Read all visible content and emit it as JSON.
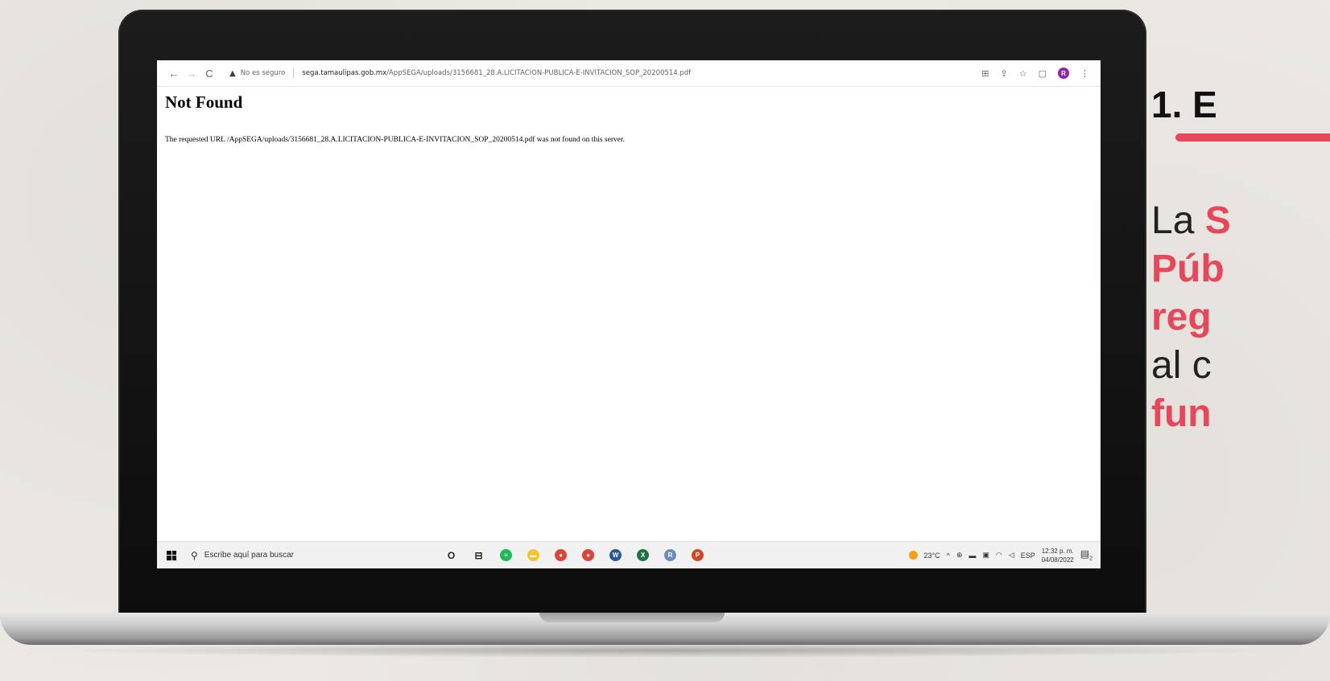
{
  "browser": {
    "back_icon": "←",
    "forward_icon": "→",
    "reload_icon": "C",
    "security_warning": "No es seguro",
    "url_host": "sega.tamaulipas.gob.mx",
    "url_path": "/AppSEGA/uploads/3156681_28.A.LICITACION-PUBLICA-E-INVITACION_SOP_20200514.pdf",
    "profile_initial": "R"
  },
  "page": {
    "heading": "Not Found",
    "message": "The requested URL /AppSEGA/uploads/3156681_28.A.LICITACION-PUBLICA-E-INVITACION_SOP_20200514.pdf was not found on this server."
  },
  "taskbar": {
    "search_placeholder": "Escribe aquí para buscar",
    "apps": [
      {
        "name": "cortana",
        "color": "#ffffff",
        "glyph": "O"
      },
      {
        "name": "task-view",
        "color": "#ffffff",
        "glyph": "⊟"
      },
      {
        "name": "spotify",
        "color": "#1db954",
        "glyph": "≡"
      },
      {
        "name": "file-explorer",
        "color": "#f4c430",
        "glyph": "▬"
      },
      {
        "name": "chrome",
        "color": "#db4437",
        "glyph": "●"
      },
      {
        "name": "chrome-profile",
        "color": "#db4437",
        "glyph": "●"
      },
      {
        "name": "word",
        "color": "#2b579a",
        "glyph": "W"
      },
      {
        "name": "excel",
        "color": "#217346",
        "glyph": "X"
      },
      {
        "name": "app-r",
        "color": "#6c8ebf",
        "glyph": "R"
      },
      {
        "name": "powerpoint",
        "color": "#d24726",
        "glyph": "P"
      }
    ],
    "temperature": "23°C",
    "language": "ESP",
    "time": "12:32 p. m.",
    "date": "04/08/2022",
    "notification_count": "2"
  },
  "slide": {
    "heading": "1. E",
    "line1_plain": "La ",
    "line1_highlight": "S",
    "line2": "Púb",
    "line3": "reg",
    "line4": "al c",
    "line5": "fun",
    "accent_color": "#e8465b"
  }
}
